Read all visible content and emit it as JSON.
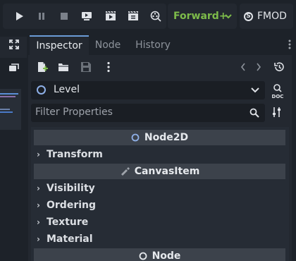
{
  "toolbar": {
    "run_buttons": [
      {
        "name": "play-icon"
      },
      {
        "name": "pause-icon"
      },
      {
        "name": "stop-icon"
      },
      {
        "name": "remote-debug-icon"
      },
      {
        "name": "play-scene-icon"
      },
      {
        "name": "play-custom-scene-icon"
      },
      {
        "name": "movie-maker-icon"
      }
    ],
    "renderer": "Forward+",
    "plugin_label": "FMOD"
  },
  "colors": {
    "renderer_green": "#7dbb4a",
    "active_tab_accent": "#6b9bd6",
    "node_icon_blue": "#8fb0e8"
  },
  "dock": {
    "tabs": [
      {
        "label": "Inspector",
        "active": true
      },
      {
        "label": "Node",
        "active": false
      },
      {
        "label": "History",
        "active": false
      }
    ],
    "selected_object": "Level",
    "filter_placeholder": "Filter Properties",
    "doc_label": "DOC"
  },
  "inspector": {
    "categories": [
      {
        "label": "Node2D",
        "icon": "node2d-icon"
      },
      {
        "label": "CanvasItem",
        "icon": "canvasitem-icon"
      },
      {
        "label": "Node",
        "icon": "node-icon"
      }
    ],
    "sections": [
      {
        "label": "Transform"
      },
      {
        "label": "Visibility"
      },
      {
        "label": "Ordering"
      },
      {
        "label": "Texture"
      },
      {
        "label": "Material"
      }
    ]
  }
}
